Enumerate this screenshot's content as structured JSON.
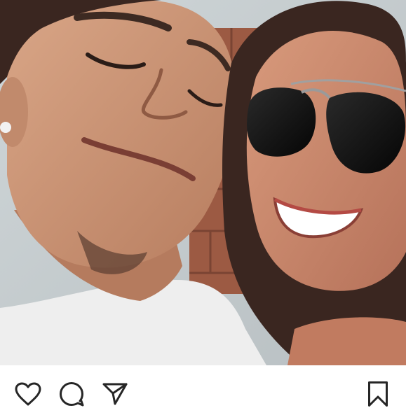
{
  "post": {
    "photo": {
      "description_icon": "photo",
      "palette": {
        "sky": "#d7dde0",
        "brick": "#9c5a43",
        "brick_dark": "#6f3a2b",
        "skin_left": "#c99474",
        "skin_right": "#c9876b",
        "shirt": "#ececec",
        "hair": "#3a2620",
        "lenses": "#141414"
      }
    },
    "actions": {
      "like_icon": "heart-outline-icon",
      "comment_icon": "comment-bubble-icon",
      "share_icon": "paper-plane-icon",
      "save_icon": "bookmark-outline-icon",
      "icon_color": "#262626"
    }
  }
}
